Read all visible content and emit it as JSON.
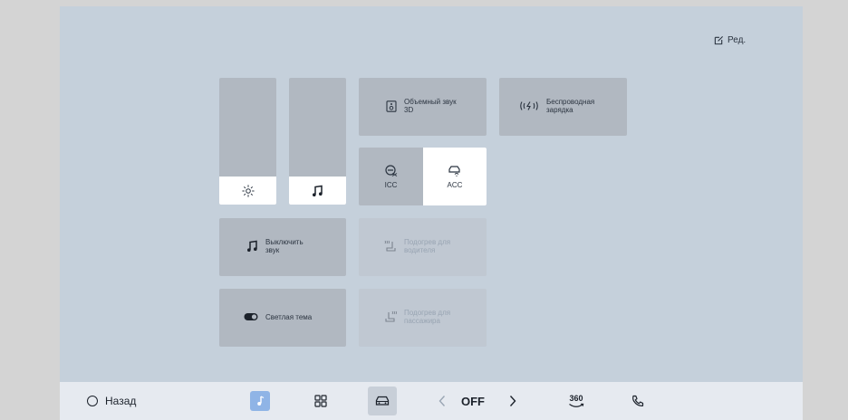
{
  "header": {
    "edit_label": "Ред."
  },
  "tiles": {
    "surround_sound": {
      "line1": "Объемный звук",
      "line2": "3D"
    },
    "wireless_charging": {
      "line1": "Беспроводная",
      "line2": "зарядка"
    },
    "icc_label": "ICC",
    "acc_label": "ACC",
    "mute": {
      "line1": "Выключить",
      "line2": "звук"
    },
    "driver_heating": {
      "line1": "Подогрев для",
      "line2": "водителя"
    },
    "light_theme": {
      "label": "Светлая тема"
    },
    "passenger_heating": {
      "line1": "Подогрев для",
      "line2": "пассажира"
    }
  },
  "sliders": {
    "brightness": {
      "level": 0.22,
      "icon": "sun-icon"
    },
    "volume": {
      "level": 0.22,
      "icon": "music-note-icon"
    }
  },
  "bottom_bar": {
    "back_label": "Назад",
    "climate_value": "OFF",
    "camera_360_label": "360"
  },
  "colors": {
    "accent": "#8fb4e6",
    "panel": "#c5d0db",
    "tile": "#b1b8c1",
    "active": "#ffffff"
  }
}
